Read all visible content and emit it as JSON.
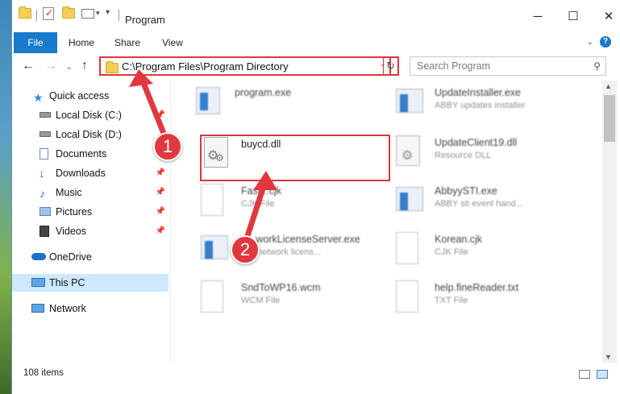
{
  "window": {
    "title": "Program",
    "minimize": "─",
    "maximize": "☐",
    "close": "✕"
  },
  "ribbon": {
    "tabs": [
      "File",
      "Home",
      "Share",
      "View"
    ],
    "help": "?"
  },
  "nav": {
    "back": "←",
    "forward": "→",
    "recent": "⌄",
    "up": "↑",
    "address": "C:\\Program Files\\Program Directory",
    "address_dropdown": "⌄",
    "refresh": "↻",
    "search_placeholder": "Search Program",
    "search_icon": "search-icon"
  },
  "sidebar": {
    "items": [
      {
        "label": "Quick access",
        "icon": "star-icon",
        "pinned": false
      },
      {
        "label": "Local Disk (C:)",
        "icon": "drive-icon",
        "pinned": true
      },
      {
        "label": "Local Disk (D:)",
        "icon": "drive-icon",
        "pinned": false
      },
      {
        "label": "Documents",
        "icon": "documents-icon",
        "pinned": true
      },
      {
        "label": "Downloads",
        "icon": "download-icon",
        "pinned": true
      },
      {
        "label": "Music",
        "icon": "music-icon",
        "pinned": true
      },
      {
        "label": "Pictures",
        "icon": "pictures-icon",
        "pinned": true
      },
      {
        "label": "Videos",
        "icon": "videos-icon",
        "pinned": true
      },
      {
        "label": "OneDrive",
        "icon": "cloud-icon",
        "pinned": false
      },
      {
        "label": "This PC",
        "icon": "computer-icon",
        "pinned": false,
        "selected": true
      },
      {
        "label": "Network",
        "icon": "network-icon",
        "pinned": false
      }
    ]
  },
  "files": [
    {
      "name": "program.exe",
      "type": ""
    },
    {
      "name": "UpdateInstaller.exe",
      "type": "ABBY updates installer"
    },
    {
      "name": "buycd.dll",
      "type": ""
    },
    {
      "name": "UpdateClient19.dll",
      "type": "Resource DLL"
    },
    {
      "name": "Fast...cjk",
      "type": "CJK File"
    },
    {
      "name": "AbbyySTI.exe",
      "type": "ABBY sti event hand..."
    },
    {
      "name": "...workLicenseServer.exe",
      "type": "... network licens..."
    },
    {
      "name": "Korean.cjk",
      "type": "CJK File"
    },
    {
      "name": "SndToWP16.wcm",
      "type": "WCM File"
    },
    {
      "name": "help.fineReader.txt",
      "type": "TXT File"
    }
  ],
  "status": {
    "item_count": "108 items"
  },
  "callouts": [
    "1",
    "2"
  ],
  "colors": {
    "accent": "#1979ca",
    "highlight": "#d9373c",
    "selected_bg": "#cde8ff"
  }
}
